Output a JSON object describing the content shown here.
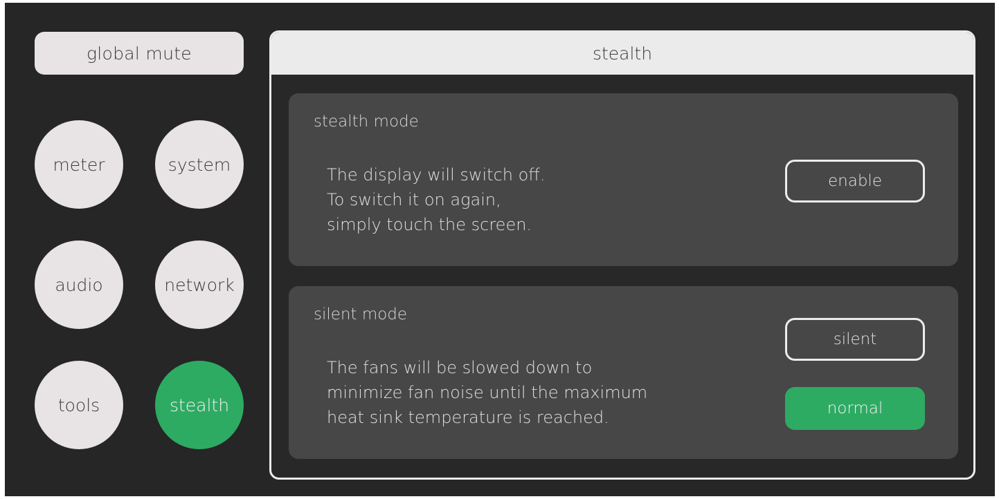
{
  "sidebar": {
    "global_mute": "global mute",
    "items": [
      {
        "id": "meter",
        "label": "meter",
        "active": false
      },
      {
        "id": "system",
        "label": "system",
        "active": false
      },
      {
        "id": "audio",
        "label": "audio",
        "active": false
      },
      {
        "id": "network",
        "label": "network",
        "active": false
      },
      {
        "id": "tools",
        "label": "tools",
        "active": false
      },
      {
        "id": "stealth",
        "label": "stealth",
        "active": true
      }
    ]
  },
  "panel": {
    "title": "stealth",
    "stealth_mode": {
      "title": "stealth mode",
      "description": "The display will switch off.\nTo switch it on again,\nsimply touch the screen.",
      "enable_label": "enable"
    },
    "silent_mode": {
      "title": "silent mode",
      "description": "The fans will be slowed down to\nminimize fan noise until the maximum\nheat sink temperature is reached.",
      "silent_label": "silent",
      "normal_label": "normal",
      "selected": "normal"
    }
  },
  "colors": {
    "background": "#262626",
    "button_light": "#e8e4e6",
    "accent": "#2eab63",
    "section": "#474747"
  }
}
